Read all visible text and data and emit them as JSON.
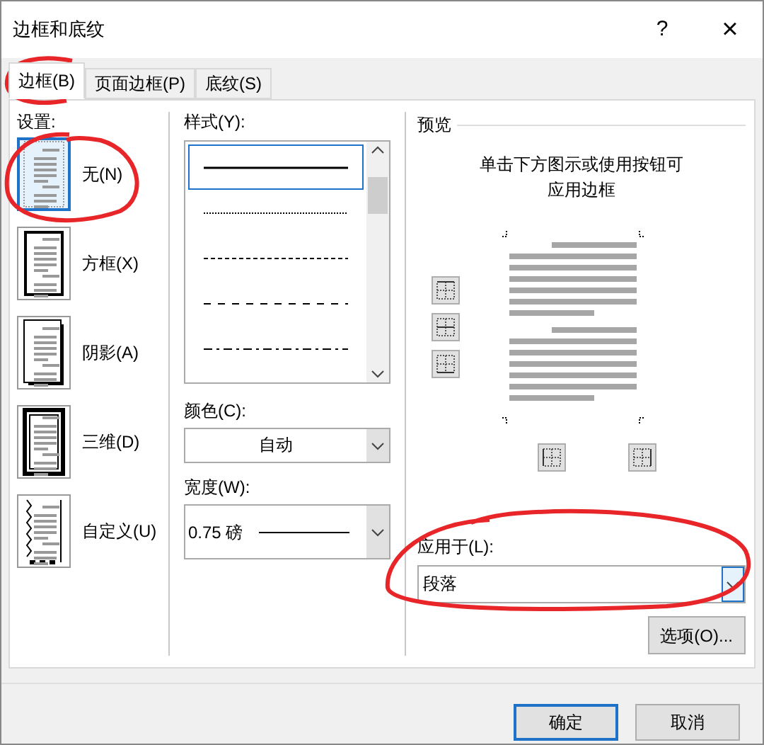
{
  "window": {
    "title": "边框和底纹",
    "help": "?",
    "close": "×"
  },
  "tabs": [
    {
      "label": "边框(B)",
      "selected": true
    },
    {
      "label": "页面边框(P)",
      "selected": false
    },
    {
      "label": "底纹(S)",
      "selected": false
    }
  ],
  "settings": {
    "label": "设置:",
    "items": [
      {
        "kind": "none",
        "label": "无(N)",
        "selected": true
      },
      {
        "kind": "box",
        "label": "方框(X)",
        "selected": false
      },
      {
        "kind": "shadow",
        "label": "阴影(A)",
        "selected": false
      },
      {
        "kind": "threed",
        "label": "三维(D)",
        "selected": false
      },
      {
        "kind": "custom",
        "label": "自定义(U)",
        "selected": false
      }
    ]
  },
  "style": {
    "label": "样式(Y):",
    "items": [
      {
        "kind": "solid",
        "selected": true
      },
      {
        "kind": "dotted",
        "selected": false
      },
      {
        "kind": "dashed-small",
        "selected": false
      },
      {
        "kind": "dashed",
        "selected": false
      },
      {
        "kind": "dash-dot",
        "selected": false
      }
    ]
  },
  "color": {
    "label": "颜色(C):",
    "value": "自动"
  },
  "width": {
    "label": "宽度(W):",
    "value": "0.75 磅"
  },
  "preview": {
    "label": "预览",
    "hint": [
      "单击下方图示或使用按钮可",
      "应用边框"
    ]
  },
  "apply_to": {
    "label": "应用于(L):",
    "value": "段落"
  },
  "options_button": "选项(O)...",
  "buttons": [
    {
      "label": "确定",
      "default": true
    },
    {
      "label": "取消",
      "default": false
    }
  ]
}
